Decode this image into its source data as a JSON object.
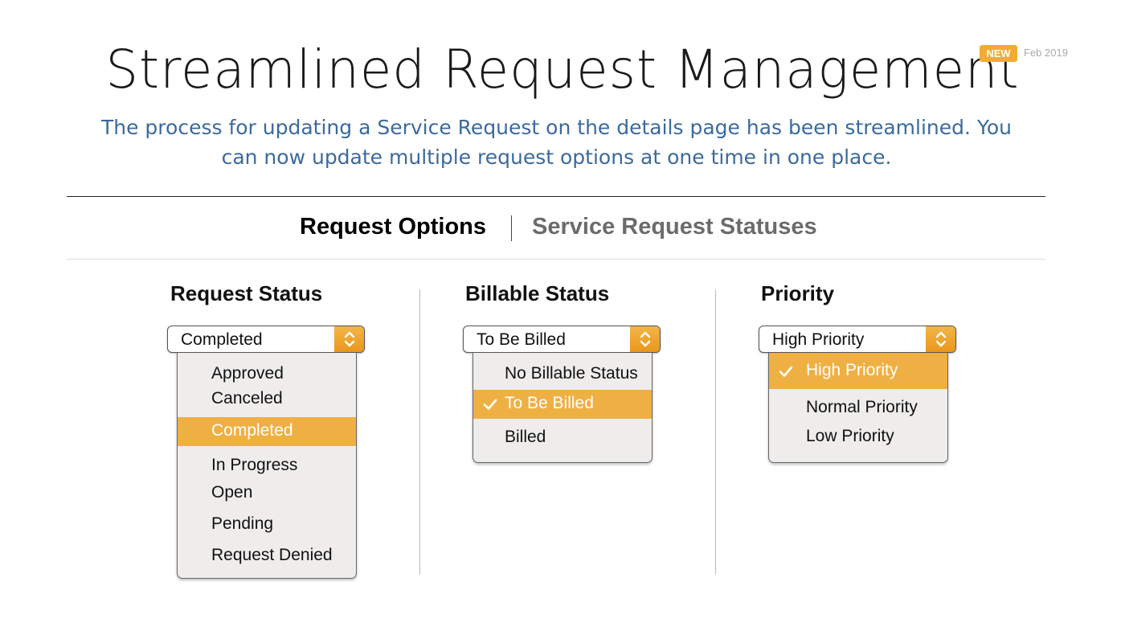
{
  "header": {
    "title": "Streamlined Request Management",
    "badge": "NEW",
    "date": "Feb 2019",
    "subtitle_line1": "The process for updating a Service Request on the details page has been streamlined. You",
    "subtitle_line2": "can now update multiple request options at one time in one place."
  },
  "tabs": [
    {
      "label": "Request Options",
      "active": true
    },
    {
      "label": "Service Request Statuses",
      "active": false
    }
  ],
  "colors": {
    "accent": "#efb043",
    "subtitle": "#3c6a9c",
    "menu_bg": "#eeedec"
  },
  "columns": [
    {
      "heading": "Request Status",
      "selected_value": "Completed",
      "options": [
        {
          "label": "Approved",
          "selected": false,
          "checked": false
        },
        {
          "label": "Canceled",
          "selected": false,
          "checked": false
        },
        {
          "label": "Completed",
          "selected": true,
          "checked": false
        },
        {
          "label": "In Progress",
          "selected": false,
          "checked": false
        },
        {
          "label": "Open",
          "selected": false,
          "checked": false
        },
        {
          "label": "Pending",
          "selected": false,
          "checked": false
        },
        {
          "label": "Request Denied",
          "selected": false,
          "checked": false
        }
      ]
    },
    {
      "heading": "Billable Status",
      "selected_value": "To Be Billed",
      "options": [
        {
          "label": "No Billable Status",
          "selected": false,
          "checked": false
        },
        {
          "label": "To Be Billed",
          "selected": true,
          "checked": true
        },
        {
          "label": "Billed",
          "selected": false,
          "checked": false
        }
      ]
    },
    {
      "heading": "Priority",
      "selected_value": "High Priority",
      "options": [
        {
          "label": "High Priority",
          "selected": true,
          "checked": true
        },
        {
          "label": "Normal Priority",
          "selected": false,
          "checked": false
        },
        {
          "label": "Low Priority",
          "selected": false,
          "checked": false
        }
      ]
    }
  ]
}
